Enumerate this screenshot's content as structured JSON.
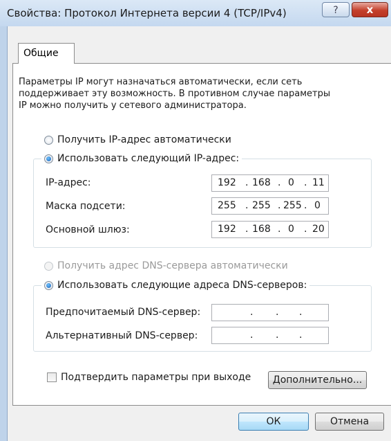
{
  "window": {
    "title": "Свойства: Протокол Интернета версии 4 (TCP/IPv4)",
    "help_label": "?",
    "close_label": "x"
  },
  "tab": {
    "label": "Общие"
  },
  "description": [
    "Параметры IP могут назначаться автоматически, если сеть",
    "поддерживает эту возможность. В противном случае параметры",
    "IP можно получить у сетевого администратора."
  ],
  "ip": {
    "auto_label": "Получить IP-адрес автоматически",
    "manual_label": "Использовать следующий IP-адрес:",
    "selected": "manual",
    "fields": [
      {
        "label": "IP-адрес:",
        "octets": [
          "192",
          "168",
          "0",
          "11"
        ]
      },
      {
        "label": "Маска подсети:",
        "octets": [
          "255",
          "255",
          "255",
          "0"
        ]
      },
      {
        "label": "Основной шлюз:",
        "octets": [
          "192",
          "168",
          "0",
          "20"
        ]
      }
    ]
  },
  "dns": {
    "auto_label": "Получить адрес DNS-сервера автоматически",
    "manual_label": "Использовать следующие адреса DNS-серверов:",
    "selected": "manual",
    "fields": [
      {
        "label": "Предпочитаемый DNS-сервер:",
        "octets": [
          "",
          "",
          "",
          ""
        ]
      },
      {
        "label": "Альтернативный DNS-сервер:",
        "octets": [
          "",
          "",
          "",
          ""
        ]
      }
    ]
  },
  "validate": {
    "label": "Подтвердить параметры при выходе",
    "checked": false
  },
  "buttons": {
    "advanced": "Дополнительно...",
    "ok": "ОК",
    "cancel": "Отмена"
  },
  "ip_separator": "."
}
